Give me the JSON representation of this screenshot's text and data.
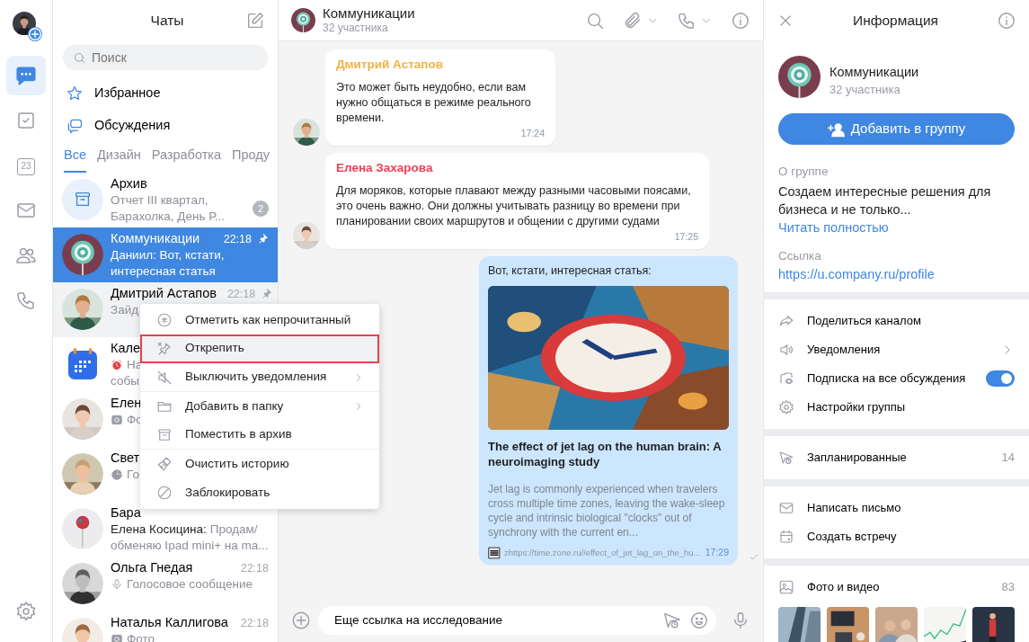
{
  "rail": {
    "items": [
      {
        "kind": "chats",
        "selected": true
      },
      {
        "kind": "tasks",
        "selected": false
      },
      {
        "kind": "calendar",
        "label": "23",
        "selected": false
      },
      {
        "kind": "mail",
        "selected": false
      },
      {
        "kind": "contacts",
        "selected": false
      },
      {
        "kind": "calls",
        "selected": false
      }
    ]
  },
  "chat_list": {
    "title": "Чаты",
    "search": {
      "placeholder": "Поиск"
    },
    "shortcuts": [
      {
        "kind": "star",
        "label": "Избранное"
      },
      {
        "kind": "threads",
        "label": "Обсуждения"
      }
    ],
    "folders": [
      {
        "label": "Все",
        "selected": true
      },
      {
        "label": "Дизайн",
        "selected": false
      },
      {
        "label": "Разработка",
        "selected": false
      },
      {
        "label": "Проду",
        "selected": false
      }
    ],
    "chats": [
      {
        "kind": "archive",
        "name": "Архив",
        "preview_lines": [
          "Отчет III квартал,",
          "Барахолка, День Р..."
        ],
        "badge": "2",
        "selected": false,
        "hovered": false,
        "pinned": false
      },
      {
        "kind": "text",
        "name": "Коммуникации",
        "time": "22:18",
        "pinned": true,
        "preview_lines": [
          "Даниил: Вот, кстати,",
          "интересная статья"
        ],
        "selected": true,
        "hovered": false
      },
      {
        "kind": "text",
        "name": "Дмитрий Астапов",
        "time": "22:18",
        "pinned": true,
        "preview_lines": [
          "Зайд"
        ],
        "selected": false,
        "hovered": true
      },
      {
        "kind": "reminder",
        "name": "Кале",
        "preview_lines": [
          "На",
          "собы"
        ],
        "selected": false,
        "hovered": false,
        "pinned": false
      },
      {
        "name": "Елен",
        "preview_lines": [
          "Фо"
        ],
        "selected": false,
        "hovered": false,
        "pinned": false
      },
      {
        "kind": "sticker",
        "name": "Свет",
        "preview_lines": [
          "Го"
        ],
        "selected": false,
        "hovered": false,
        "pinned": false
      },
      {
        "kind": "text",
        "name": "Бара",
        "sender": "Елена Косицина:",
        "preview_lines": [
          "Продам/",
          "обменяю Ipad mini+ на ma..."
        ],
        "selected": false,
        "hovered": false,
        "pinned": false
      },
      {
        "kind": "voice",
        "name": "Ольга Гнедая",
        "time": "22:18",
        "preview_lines": [
          "Голосовое сообщение"
        ],
        "selected": false,
        "hovered": false,
        "pinned": false
      },
      {
        "name": "Наталья Каллигова",
        "time": "22:18",
        "preview_lines": [
          "Фото"
        ],
        "selected": false,
        "hovered": false,
        "pinned": false
      }
    ]
  },
  "context_menu": {
    "items": [
      {
        "kind": "unread",
        "label": "Отметить как непрочитанный",
        "submenu": false,
        "selected": false,
        "divider_after": false
      },
      {
        "kind": "unpin",
        "label": "Открепить",
        "submenu": false,
        "selected": true,
        "divider_after": true
      },
      {
        "kind": "mute",
        "label": "Выключить уведомления",
        "submenu": true,
        "selected": false,
        "divider_after": true
      },
      {
        "kind": "folder",
        "label": "Добавить в папку",
        "submenu": true,
        "selected": false,
        "divider_after": false
      },
      {
        "kind": "archive",
        "label": "Поместить в архив",
        "submenu": false,
        "selected": false,
        "divider_after": true
      },
      {
        "kind": "clear",
        "label": "Очистить историю",
        "submenu": false,
        "selected": false,
        "divider_after": false
      },
      {
        "kind": "block",
        "label": "Заблокировать",
        "submenu": false,
        "selected": false,
        "divider_after": false
      }
    ]
  },
  "chat": {
    "title": "Коммуникации",
    "subtitle": "32 участника",
    "messages": [
      {
        "kind": "incoming",
        "author": "Дмитрий Астапов",
        "color": "#f0b341",
        "text": "Это может быть неудобно, если вам нужно общаться в режиме реального времени.",
        "time": "17:24"
      },
      {
        "kind": "incoming",
        "author": "Елена Захарова",
        "color": "#f23d55",
        "text": "Для моряков, которые плавают между разными часовыми поясами, это очень важно. Они должны учитывать разницу во времени при планировании своих маршрутов и общении с другими судами",
        "time": "17:25"
      },
      {
        "kind": "outgoing",
        "text": "Вот, кстати, интересная статья:",
        "link": {
          "title": "The effect of jet lag on the human brain: A neuroimaging study",
          "description": "Jet lag is commonly experienced when travelers cross multiple time zones, leaving the wake-sleep cycle and intrinsic biological \"clocks\" out of synchrony with the current en...",
          "url": "zhttps://time.zone.ru//effect_of_jet_lag_on_the_hu..."
        },
        "time": "17:29",
        "read": true
      }
    ],
    "composer": {
      "value": "Еще ссылка на исследование"
    }
  },
  "info": {
    "title": "Информация",
    "name": "Коммуникации",
    "members": "32 участника",
    "add_button": "Добавить в группу",
    "about_label": "О группе",
    "about": "Создаем интересные решения для бизнеса и не только...",
    "read_more": "Читать полностью",
    "link_label": "Ссылка",
    "link": "https://u.company.ru/profile",
    "sections": [
      [
        {
          "kind": "share",
          "label": "Поделиться каналом"
        },
        {
          "kind": "notifications",
          "label": "Уведомления",
          "chevron": true
        },
        {
          "kind": "subscription",
          "label": "Подписка на все обсуждения",
          "on": true
        },
        {
          "kind": "settings",
          "label": "Настройки группы"
        }
      ],
      [
        {
          "kind": "scheduled",
          "label": "Запланированные",
          "count": "14"
        }
      ],
      [
        {
          "kind": "mail",
          "label": "Написать письмо"
        },
        {
          "kind": "meeting",
          "label": "Создать встречу"
        }
      ],
      [
        {
          "kind": "media",
          "label": "Фото и видео",
          "count": "83"
        }
      ]
    ]
  }
}
